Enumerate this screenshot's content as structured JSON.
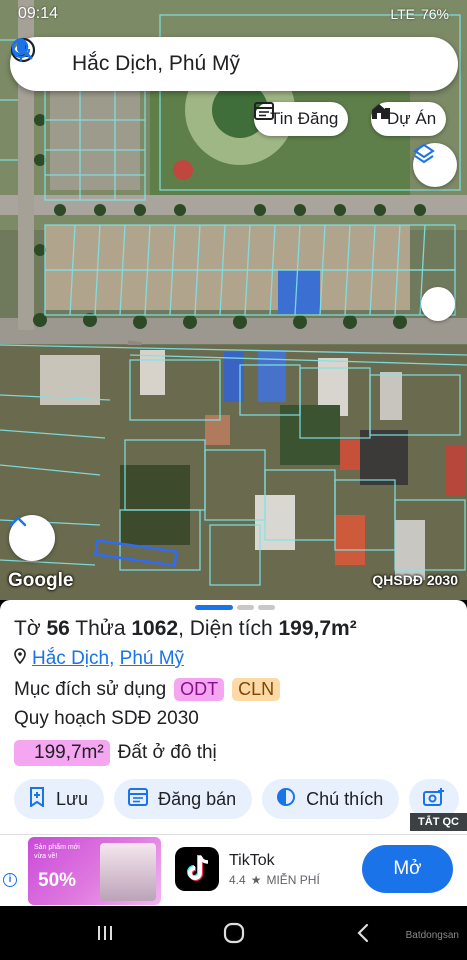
{
  "status_bar": {
    "time": "09:14",
    "network": "LTE",
    "battery": "76%"
  },
  "search": {
    "query": "Hắc Dịch, Phú Mỹ"
  },
  "chips": {
    "tin_dang": "Tin Đăng",
    "du_an": "Dự Án"
  },
  "map": {
    "attribution": "Google",
    "overlay_label": "QHSDĐ 2030"
  },
  "parcel": {
    "label_to": "Tờ",
    "to_number": "56",
    "label_thua": "Thửa",
    "thua_number": "1062",
    "label_area": ", Diện tích",
    "area": "199,7m²",
    "location_ward": "Hắc Dịch",
    "location_sep": ",",
    "location_city": "Phú Mỹ",
    "purpose_label": "Mục đích sử dụng",
    "purpose_codes": [
      "ODT",
      "CLN"
    ],
    "plan_title": "Quy hoạch SDĐ 2030",
    "plan_area": "199,7m²",
    "plan_use": "Đất ở đô thị"
  },
  "actions": {
    "save": "Lưu",
    "post_sale": "Đăng bán",
    "legend": "Chú thích"
  },
  "ad": {
    "badge": "TẮT QC",
    "promo_text": "Sản phẩm mới vừa về!",
    "promo_discount": "50%",
    "app_name": "TikTok",
    "rating": "4.4",
    "price": "MIỄN PHÍ",
    "cta": "Mở"
  },
  "watermark": "Batdongsan",
  "colors": {
    "accent": "#1a73e8",
    "odt_badge": "#f4a6f1",
    "cln_badge": "#fcd9a6",
    "parcel_lines": "#7fe3e6"
  }
}
